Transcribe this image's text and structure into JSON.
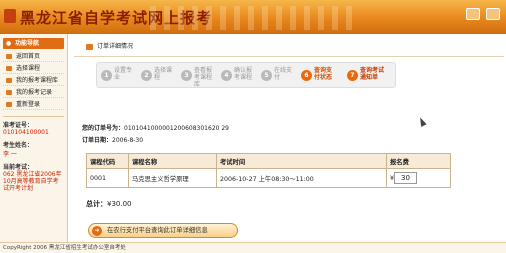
{
  "header": {
    "title": "黑龙江省自学考试网上报考"
  },
  "sidebar": {
    "nav_title": "功能导航",
    "items": [
      {
        "label": "返回首页"
      },
      {
        "label": "选择课程"
      },
      {
        "label": "我的报考课程库"
      },
      {
        "label": "我的报考记录"
      },
      {
        "label": "重新登录"
      }
    ],
    "ticket_label": "准考证号：",
    "ticket_value": "010104100001",
    "name_label": "考生姓名：",
    "name_value": "李 一",
    "exam_label": "当前考试：",
    "exam_value": "062 黑龙江省2006年10月高等教育自学考试开考计划"
  },
  "main": {
    "breadcrumb": "订单详细情况",
    "steps": [
      {
        "num": "1",
        "label": "设置专业"
      },
      {
        "num": "2",
        "label": "选择课程"
      },
      {
        "num": "3",
        "label": "查看报考课程库"
      },
      {
        "num": "4",
        "label": "确认报考课程"
      },
      {
        "num": "5",
        "label": "在线支付"
      },
      {
        "num": "6",
        "label": "查询支付状态"
      },
      {
        "num": "7",
        "label": "查询考试通知单"
      }
    ],
    "order_no_label": "您的订单号为：",
    "order_no_value": "0101041000001200608301620 29",
    "order_date_label": "订单日期：",
    "order_date_value": "2006-8-30",
    "table": {
      "headers": [
        "课程代码",
        "课程名称",
        "考试时间",
        "报名费"
      ],
      "rows": [
        {
          "code": "0001",
          "name": "马克思主义哲学原理",
          "time": "2006-10-27 上午08:30～11:00",
          "fee_symbol": "¥",
          "fee": "30"
        }
      ]
    },
    "total_label": "总计：",
    "total_value": "¥30.00",
    "pay_button": "在农行支付平台查询此订单详细信息"
  },
  "footer": {
    "text": "CopyRight 2006 黑龙江省招生考试办公室自考处"
  }
}
